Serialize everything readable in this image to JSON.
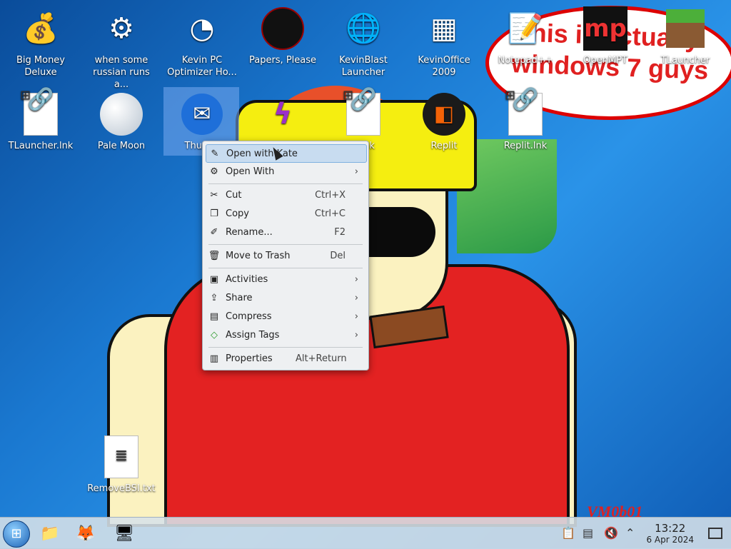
{
  "wallpaper": {
    "bubble_text": "this is actually windows 7 guys",
    "watermark": "VM0b01"
  },
  "desktop_icons": [
    {
      "label": "Big Money Deluxe",
      "icon": "money-bag-icon"
    },
    {
      "label": "when some russian runs a...",
      "icon": "gear-icon"
    },
    {
      "label": "Kevin PC Optimizer Ho...",
      "icon": "gauge-icon"
    },
    {
      "label": "Papers, Please",
      "icon": "papers-please-icon"
    },
    {
      "label": "KevinBlast Launcher",
      "icon": "globe-icon"
    },
    {
      "label": "KevinOffice 2009",
      "icon": "office-icon"
    },
    {
      "label": "Notepad++",
      "icon": "notepad-icon"
    },
    {
      "label": "OpenMPT",
      "icon": "openmpt-icon"
    },
    {
      "label": "TLauncher",
      "icon": "grass-block-icon"
    },
    {
      "label": "TLauncher.lnk",
      "icon": "shortcut-icon"
    },
    {
      "label": "Pale Moon",
      "icon": "moon-icon"
    },
    {
      "label": "Thunde",
      "icon": "thunderbird-icon"
    },
    {
      "label": "",
      "icon": "app-icon"
    },
    {
      "label": "d.lnk",
      "icon": "shortcut-icon"
    },
    {
      "label": "Replit",
      "icon": "replit-icon"
    },
    {
      "label": "Replit.lnk",
      "icon": "shortcut-icon"
    },
    {
      "label": "RemoveBSI.txt",
      "icon": "text-file-icon"
    }
  ],
  "context_menu": {
    "items": [
      {
        "label": "Open with Kate",
        "shortcut": "",
        "icon": "kate-icon",
        "submenu": false
      },
      {
        "label": "Open With",
        "shortcut": "",
        "icon": "open-with-icon",
        "submenu": true
      },
      {
        "label": "Cut",
        "shortcut": "Ctrl+X",
        "icon": "scissors-icon",
        "submenu": false
      },
      {
        "label": "Copy",
        "shortcut": "Ctrl+C",
        "icon": "copy-icon",
        "submenu": false
      },
      {
        "label": "Rename...",
        "shortcut": "F2",
        "icon": "rename-icon",
        "submenu": false
      },
      {
        "label": "Move to Trash",
        "shortcut": "Del",
        "icon": "trash-icon",
        "submenu": false
      },
      {
        "label": "Activities",
        "shortcut": "",
        "icon": "activities-icon",
        "submenu": true
      },
      {
        "label": "Share",
        "shortcut": "",
        "icon": "share-icon",
        "submenu": true
      },
      {
        "label": "Compress",
        "shortcut": "",
        "icon": "compress-icon",
        "submenu": true
      },
      {
        "label": "Assign Tags",
        "shortcut": "",
        "icon": "tag-icon",
        "submenu": true
      },
      {
        "label": "Properties",
        "shortcut": "Alt+Return",
        "icon": "properties-icon",
        "submenu": false
      }
    ]
  },
  "taskbar": {
    "apps": [
      "start-icon",
      "file-manager-icon",
      "firefox-icon",
      "system-settings-icon"
    ],
    "tray": [
      "clipboard-icon",
      "notes-icon",
      "volume-muted-icon",
      "chevron-up-icon"
    ],
    "time": "13:22",
    "date": "6 Apr 2024"
  }
}
